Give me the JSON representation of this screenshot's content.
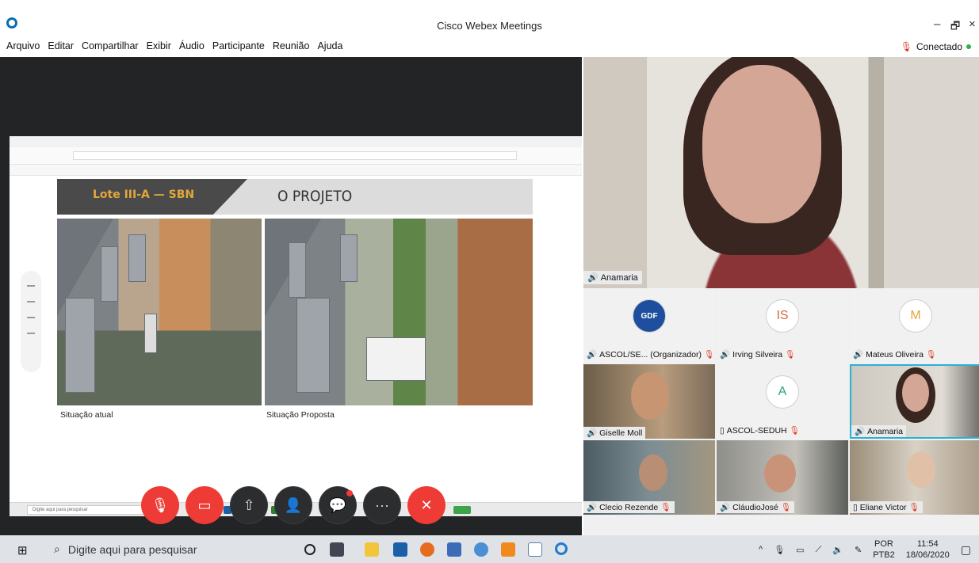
{
  "window": {
    "title": "Cisco Webex Meetings",
    "min": "–",
    "max": "🗗",
    "close": "×"
  },
  "menu": [
    "Arquivo",
    "Editar",
    "Compartilhar",
    "Exibir",
    "Áudio",
    "Participante",
    "Reunião",
    "Ajuda"
  ],
  "status": {
    "label": "Conectado",
    "color": "#2eb34a"
  },
  "shared_content": {
    "slide_tag": "Lote III-A — SBN",
    "slide_title": "O PROJETO",
    "captions": [
      "Situação atual",
      "Situação Proposta"
    ],
    "inner_search": "Digite aqui para pesquisar"
  },
  "controls": {
    "mute": "🎙",
    "video": "▭",
    "share": "⇧",
    "participants": "👤",
    "chat": "💬",
    "more": "···",
    "leave": "✕"
  },
  "active_speaker": {
    "name": "Anamaria"
  },
  "participants": [
    {
      "name": "ASCOL/SE... (Organizador)",
      "avatar": "GDF",
      "muted": true
    },
    {
      "name": "Irving Silveira",
      "avatar": "IS",
      "muted": true
    },
    {
      "name": "Mateus Oliveira",
      "avatar": "M",
      "muted": true
    },
    {
      "name": "Giselle Moll",
      "avatar": "",
      "muted": false
    },
    {
      "name": "ASCOL-SEDUH",
      "avatar": "A",
      "muted": true
    },
    {
      "name": "Anamaria",
      "avatar": "",
      "muted": false
    },
    {
      "name": "Clecio Rezende",
      "avatar": "",
      "muted": true
    },
    {
      "name": "CláudioJosé",
      "avatar": "",
      "muted": true
    },
    {
      "name": "Eliane Victor",
      "avatar": "",
      "muted": true
    }
  ],
  "taskbar": {
    "search_placeholder": "Digite aqui para pesquisar",
    "lang_top": "POR",
    "lang_bottom": "PTB2",
    "time": "11:54",
    "date": "18/06/2020"
  }
}
